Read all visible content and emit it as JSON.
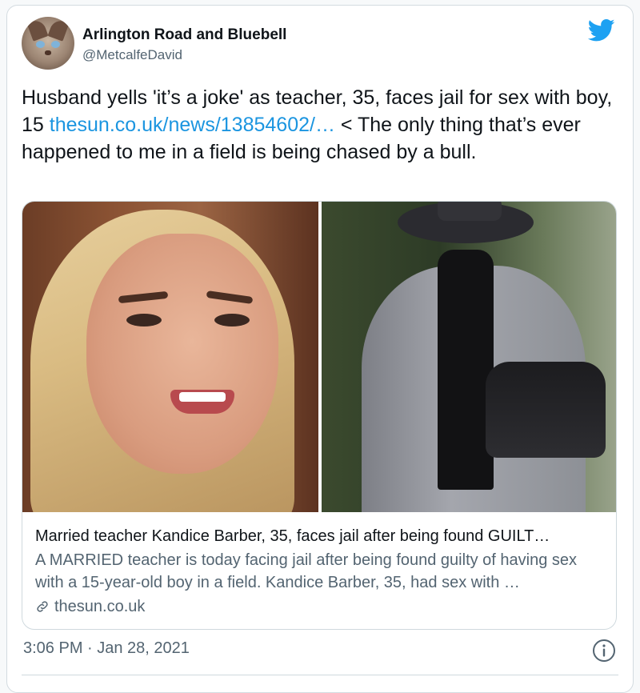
{
  "author": {
    "display_name": "Arlington Road and Bluebell",
    "handle": "@MetcalfeDavid",
    "avatar_icon": "cat-avatar"
  },
  "tweet": {
    "text_before_link": "Husband yells 'it’s a joke' as teacher, 35, faces jail for sex with boy, 15 ",
    "link_text": "thesun.co.uk/news/13854602/…",
    "text_after_link": " < The only thing that’s ever happened to me in a field is being chased by a bull."
  },
  "card": {
    "title": "Married teacher Kandice Barber, 35, faces jail after being found GUILT…",
    "description": "A MARRIED teacher is today facing jail after being found guilty of having sex with a 15-year-old boy in a field. Kandice Barber, 35, had sex with …",
    "domain": "thesun.co.uk"
  },
  "meta": {
    "timestamp": "3:06 PM · Jan 28, 2021"
  },
  "colors": {
    "link": "#1b95e0",
    "secondary_text": "#536471",
    "twitter_blue": "#1da1f2"
  }
}
